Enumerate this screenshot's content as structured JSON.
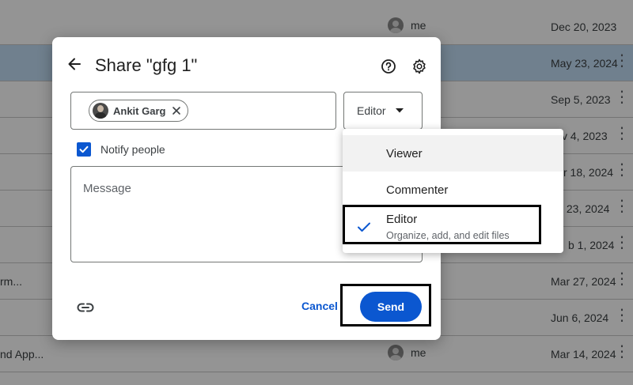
{
  "background_list": {
    "rows": [
      {
        "name": "",
        "owner": "me",
        "date": "Dec 20, 2023",
        "selected": false
      },
      {
        "name": "",
        "owner": "",
        "date": "May 23, 2024",
        "selected": true
      },
      {
        "name": "",
        "owner": "",
        "date": "Sep 5, 2023",
        "selected": false
      },
      {
        "name": "",
        "owner": "",
        "date": "v 4, 2023",
        "selected": false
      },
      {
        "name": "",
        "owner": "",
        "date": "r 18, 2024",
        "selected": false
      },
      {
        "name": "",
        "owner": "",
        "date": "y 23, 2024",
        "selected": false
      },
      {
        "name": "",
        "owner": "",
        "date": "b 1, 2024",
        "selected": false
      },
      {
        "name": "rm...",
        "owner": "",
        "date": "Mar 27, 2024",
        "selected": false
      },
      {
        "name": "",
        "owner": "",
        "date": "Jun 6, 2024",
        "selected": false
      },
      {
        "name": "nd App...",
        "owner": "me",
        "date": "Mar 14, 2024",
        "selected": false
      }
    ]
  },
  "dialog": {
    "title": "Share \"gfg 1\"",
    "icons": {
      "back": "arrow-back-icon",
      "help": "help-icon",
      "settings": "gear-icon"
    },
    "people_chip": {
      "name": "Ankit Garg"
    },
    "role_select": {
      "value": "Editor"
    },
    "notify": {
      "label": "Notify people",
      "checked": true
    },
    "message": {
      "placeholder": "Message"
    },
    "footer": {
      "cancel_label": "Cancel",
      "send_label": "Send"
    }
  },
  "role_menu": {
    "items": [
      {
        "label": "Viewer",
        "description": "",
        "selected": false
      },
      {
        "label": "Commenter",
        "description": "",
        "selected": false
      },
      {
        "label": "Editor",
        "description": "Organize, add, and edit files",
        "selected": true
      }
    ]
  },
  "colors": {
    "primary": "#0b57d0",
    "overlay": "rgba(0,0,0,0.42)",
    "selected_row": "#c2dcf5",
    "highlight_box": "#000000"
  }
}
